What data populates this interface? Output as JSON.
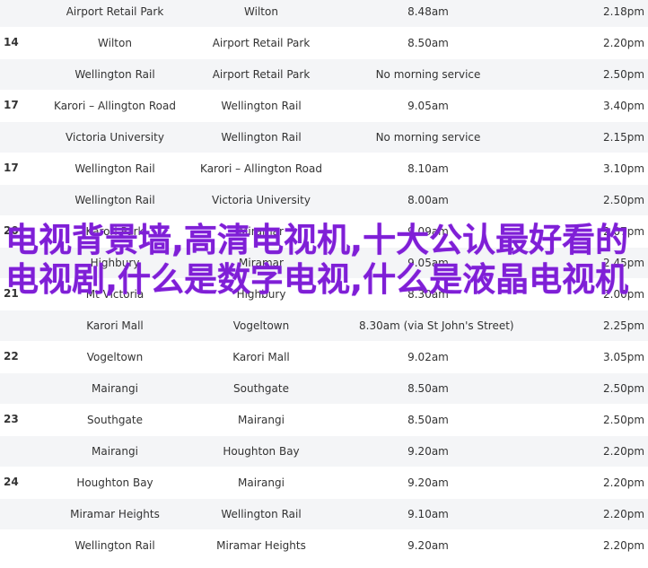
{
  "table": {
    "rows": [
      {
        "shade": true,
        "from": "Airport Retail Park",
        "to": "Wilton",
        "depart": "8.48am",
        "return": "2.18pm"
      },
      {
        "shade": false,
        "from": "Wilton",
        "to": "Airport Retail Park",
        "depart": "8.50am",
        "return": "2.20pm"
      },
      {
        "shade": true,
        "from": "Wellington Rail",
        "to": "Airport Retail Park",
        "depart": "No morning service",
        "return": "2.50pm"
      },
      {
        "shade": false,
        "from": "Karori – Allington Road",
        "to": "Wellington Rail",
        "depart": "9.05am",
        "return": "3.40pm"
      },
      {
        "shade": true,
        "from": "Victoria University",
        "to": "Wellington Rail",
        "depart": "No morning service",
        "return": "2.15pm"
      },
      {
        "shade": false,
        "from": "Wellington Rail",
        "to": "Karori – Allington Road",
        "depart": "8.10am",
        "return": "3.10pm"
      },
      {
        "shade": true,
        "from": "Wellington Rail",
        "to": "Victoria University",
        "depart": "8.00am",
        "return": "2.50pm"
      },
      {
        "shade": false,
        "from": "Karori Park",
        "to": "Miramar",
        "depart": "9.09am",
        "return": "2.07pm"
      },
      {
        "shade": true,
        "from": "Highbury",
        "to": "Miramar",
        "depart": "9.05am",
        "return": "2.45pm"
      },
      {
        "shade": false,
        "from": "Mt Victoria",
        "to": "Highbury",
        "depart": "8.30am",
        "return": "2.00pm"
      },
      {
        "shade": true,
        "from": "Karori Mall",
        "to": "Vogeltown",
        "depart": "8.30am (via St John's Street)",
        "return": "2.25pm"
      },
      {
        "shade": false,
        "from": "Vogeltown",
        "to": "Karori Mall",
        "depart": "9.02am",
        "return": "3.05pm"
      },
      {
        "shade": true,
        "from": "Mairangi",
        "to": "Southgate",
        "depart": "8.50am",
        "return": "2.50pm"
      },
      {
        "shade": false,
        "from": "Southgate",
        "to": "Mairangi",
        "depart": "8.50am",
        "return": "2.50pm"
      },
      {
        "shade": true,
        "from": "Mairangi",
        "to": "Houghton Bay",
        "depart": "9.20am",
        "return": "2.20pm"
      },
      {
        "shade": false,
        "from": "Houghton Bay",
        "to": "Mairangi",
        "depart": "9.20am",
        "return": "2.20pm"
      },
      {
        "shade": true,
        "from": "Miramar Heights",
        "to": "Wellington Rail",
        "depart": "9.10am",
        "return": "2.20pm"
      },
      {
        "shade": false,
        "from": "Wellington Rail",
        "to": "Miramar Heights",
        "depart": "9.20am",
        "return": "2.20pm"
      }
    ],
    "group_numbers": [
      {
        "label": "14"
      },
      {
        "label": "17"
      },
      {
        "label": "17"
      },
      {
        "label": "20"
      },
      {
        "label": "21"
      },
      {
        "label": "22"
      },
      {
        "label": "23"
      },
      {
        "label": "24"
      }
    ]
  },
  "overlay": {
    "text": "电视背景墙,高清电视机,十大公认最好看的电视剧,什么是数字电视,什么是液晶电视机"
  }
}
